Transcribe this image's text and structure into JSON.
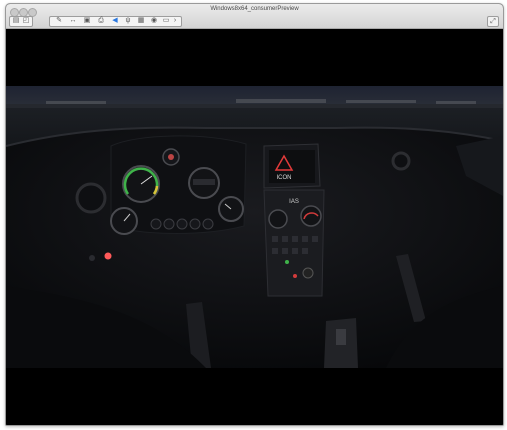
{
  "window": {
    "title": "Windows8x64_consumerPreview",
    "close_control": "close",
    "minimize_control": "minimize",
    "zoom_control": "zoom"
  },
  "toolbar": {
    "buttons": [
      {
        "icon": "sidebar-icon"
      },
      {
        "icon": "snapshot-icon"
      },
      {
        "icon": "settings-wrench-icon"
      },
      {
        "icon": "resize-arrows-icon"
      },
      {
        "icon": "harddisk-icon"
      },
      {
        "icon": "printer-icon"
      },
      {
        "icon": "sound-icon"
      },
      {
        "icon": "usb-icon"
      },
      {
        "icon": "lock-icon"
      },
      {
        "icon": "cdrom-icon"
      },
      {
        "icon": "folder-icon"
      },
      {
        "icon": "chevron-right-icon"
      }
    ],
    "fullscreen_icon": "fullscreen-icon"
  },
  "scene": {
    "cockpit_display": {
      "logo_text": "ICON"
    },
    "panel_badge": "IAS",
    "colors": {
      "sky": "#1a1f2e",
      "ground": "#121418",
      "dash": "#0b0c0f",
      "gauge_ring": "#3a3b3f",
      "gauge_green": "#3fb34a",
      "gauge_yellow": "#d8c23a",
      "gauge_red": "#d23b3b",
      "screen_red": "#e23a3a",
      "led_red": "#ff5a5a"
    }
  }
}
